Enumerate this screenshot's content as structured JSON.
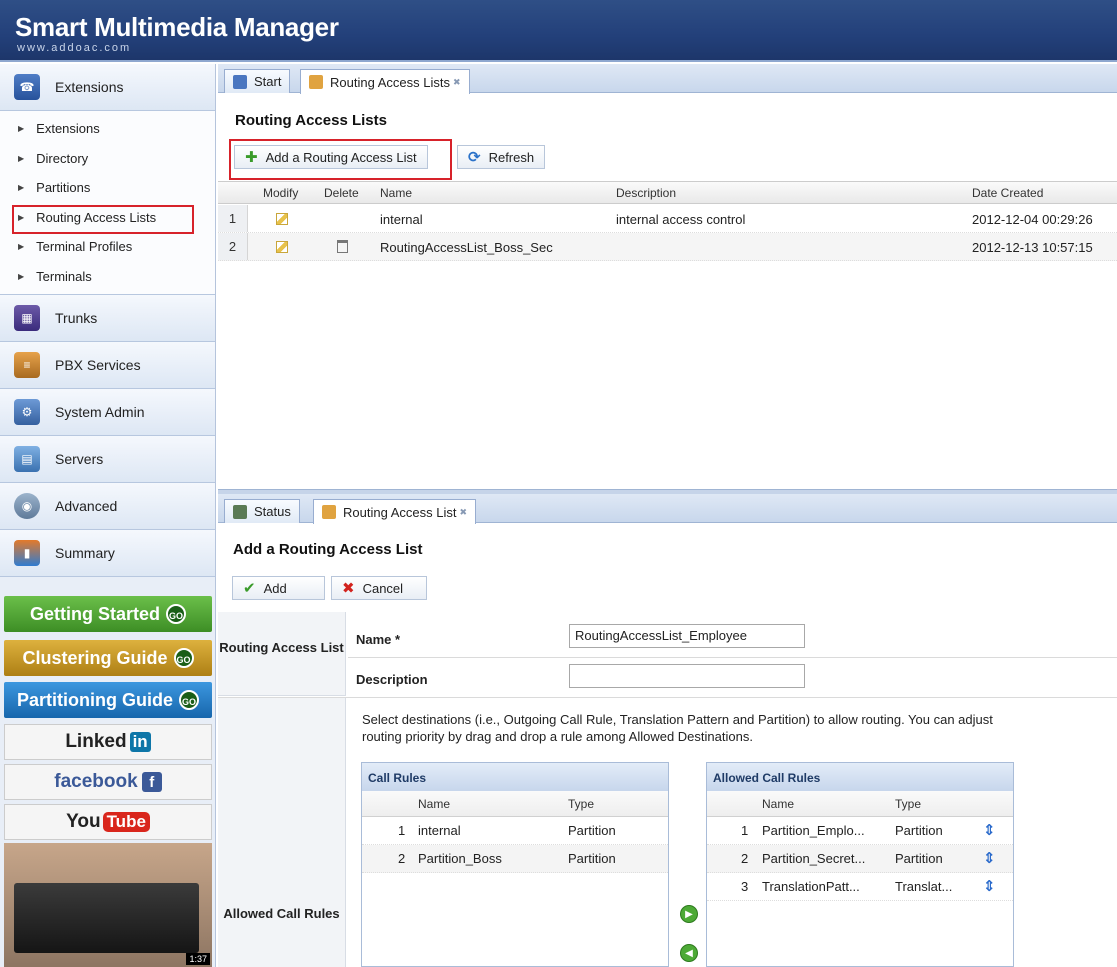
{
  "app": {
    "title": "Smart Multimedia Manager",
    "subtitle": "www.addoac.com"
  },
  "sidebar": {
    "sections": [
      {
        "label": "Extensions",
        "icon": "extensions-icon"
      },
      {
        "label": "Trunks",
        "icon": "trunks-icon"
      },
      {
        "label": "PBX Services",
        "icon": "pbx-services-icon"
      },
      {
        "label": "System Admin",
        "icon": "system-admin-icon"
      },
      {
        "label": "Servers",
        "icon": "servers-icon"
      },
      {
        "label": "Advanced",
        "icon": "advanced-icon"
      },
      {
        "label": "Summary",
        "icon": "summary-icon"
      }
    ],
    "items": [
      "Extensions",
      "Directory",
      "Partitions",
      "Routing Access Lists",
      "Terminal Profiles",
      "Terminals"
    ],
    "selected_item": "Routing Access Lists",
    "promos": {
      "getting_started": "Getting Started",
      "clustering": "Clustering Guide",
      "partitioning": "Partitioning Guide",
      "go": "GO"
    },
    "social": {
      "linkedin": "Linked",
      "linkedin_in": "in",
      "facebook": "facebook",
      "youtube_you": "You",
      "youtube_tube": "Tube"
    },
    "video_time": "1:37"
  },
  "top": {
    "tabs": [
      {
        "label": "Start"
      },
      {
        "label": "Routing Access Lists"
      }
    ],
    "title": "Routing Access Lists",
    "toolbar": {
      "add_label": "Add a Routing Access List",
      "refresh_label": "Refresh"
    },
    "columns": {
      "modify": "Modify",
      "delete": "Delete",
      "name": "Name",
      "description": "Description",
      "date": "Date Created"
    },
    "rows": [
      {
        "num": "1",
        "name": "internal",
        "description": "internal access control",
        "date": "2012-12-04 00:29:26",
        "deletable": false
      },
      {
        "num": "2",
        "name": "RoutingAccessList_Boss_Sec",
        "description": "",
        "date": "2012-12-13 10:57:15",
        "deletable": true
      }
    ]
  },
  "bottom": {
    "tabs": [
      {
        "label": "Status"
      },
      {
        "label": "Routing Access List"
      }
    ],
    "title": "Add a Routing Access List",
    "toolbar": {
      "add_label": "Add",
      "cancel_label": "Cancel"
    },
    "form": {
      "section1_label": "Routing Access List",
      "name_label": "Name *",
      "name_value": "RoutingAccessList_Employee",
      "description_label": "Description",
      "description_value": "",
      "section2_label": "Allowed Call Rules",
      "hint": "Select destinations (i.e., Outgoing Call Rule, Translation Pattern and Partition) to allow routing. You can adjust routing priority by drag and drop a rule among Allowed Destinations."
    },
    "call_rules": {
      "title": "Call Rules",
      "columns": {
        "name": "Name",
        "type": "Type"
      },
      "rows": [
        {
          "num": "1",
          "name": "internal",
          "type": "Partition"
        },
        {
          "num": "2",
          "name": "Partition_Boss",
          "type": "Partition"
        }
      ]
    },
    "allowed_rules": {
      "title": "Allowed Call Rules",
      "columns": {
        "name": "Name",
        "type": "Type"
      },
      "rows": [
        {
          "num": "1",
          "name": "Partition_Emplo...",
          "type": "Partition"
        },
        {
          "num": "2",
          "name": "Partition_Secret...",
          "type": "Partition"
        },
        {
          "num": "3",
          "name": "TranslationPatt...",
          "type": "Translat..."
        }
      ]
    }
  }
}
